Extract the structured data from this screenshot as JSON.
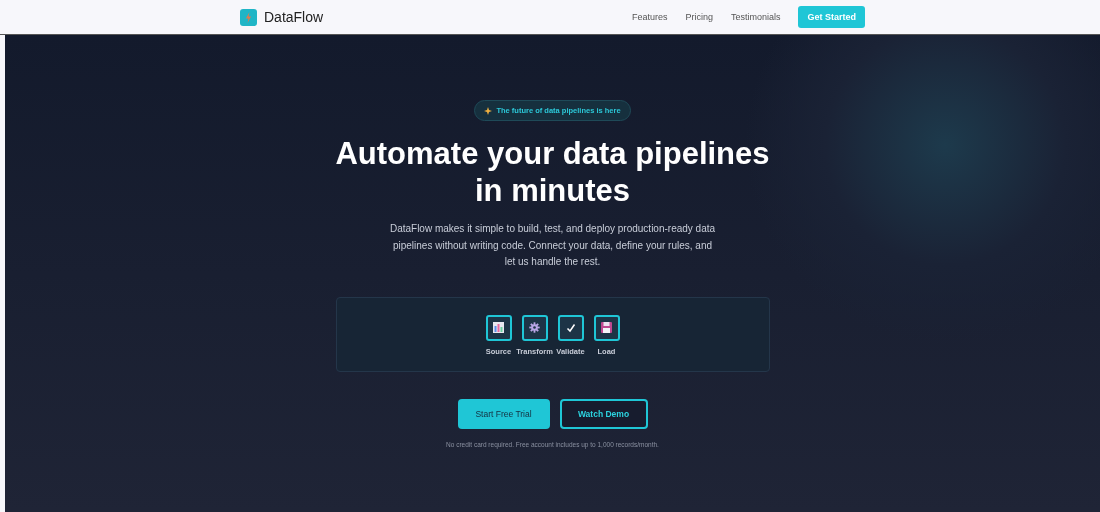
{
  "nav": {
    "brand": "DataFlow",
    "links": [
      "Features",
      "Pricing",
      "Testimonials"
    ],
    "cta": "Get Started"
  },
  "hero": {
    "badge": "The future of data pipelines is here",
    "title_lines": [
      "Automate your data pipelines",
      "in minutes"
    ],
    "subtitle": "DataFlow makes it simple to build, test, and deploy production-ready data pipelines without writing code. Connect your data, define your rules, and let us handle the rest.",
    "steps": [
      {
        "kind": "chart",
        "label": "Source"
      },
      {
        "kind": "gear",
        "label": "Transform"
      },
      {
        "kind": "check",
        "label": "Validate"
      },
      {
        "kind": "disk",
        "label": "Load"
      }
    ],
    "primary_button": "Start Free Trial",
    "secondary_button": "Watch Demo",
    "note": "No credit card required. Free account includes up to 1,000 records/month."
  }
}
